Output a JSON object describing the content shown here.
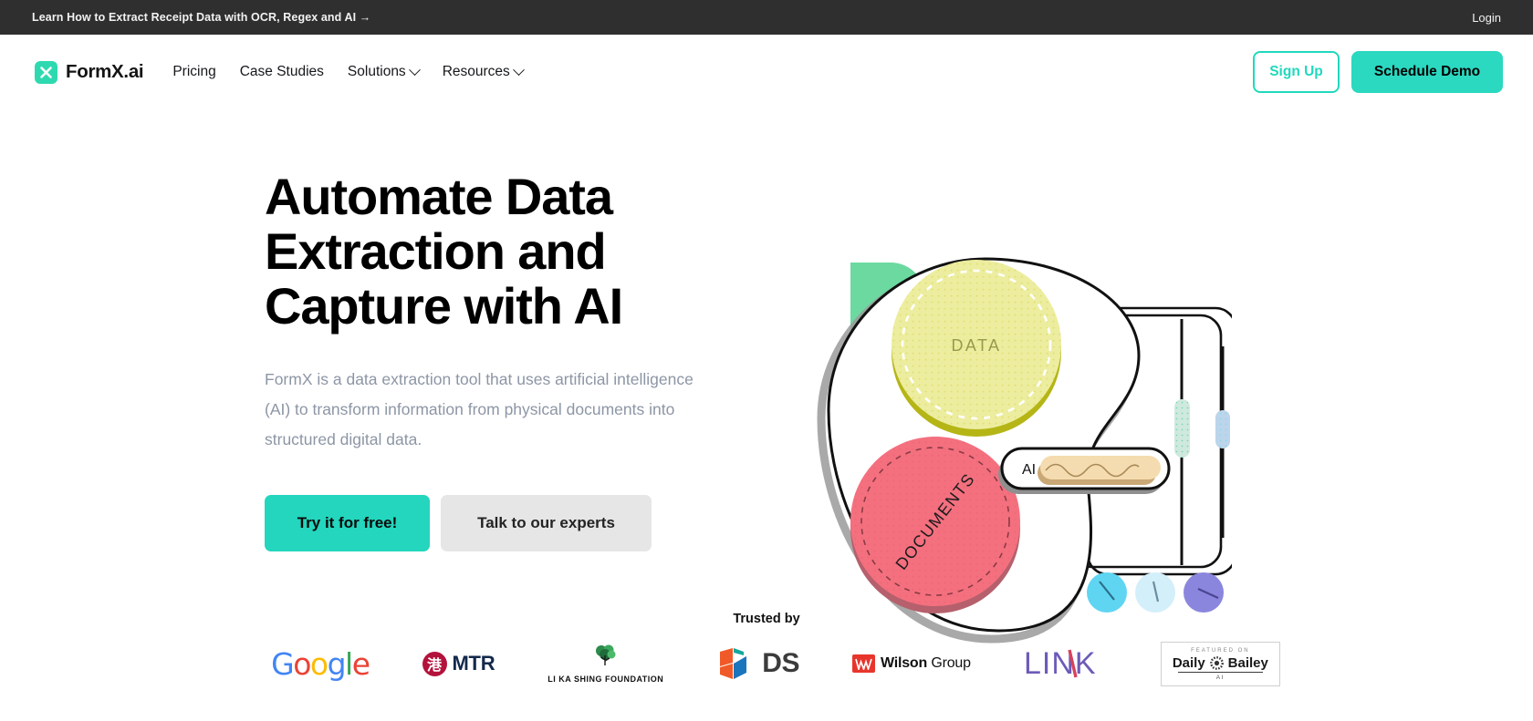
{
  "topbar": {
    "announcement": "Learn How to Extract Receipt Data with OCR, Regex and AI →",
    "login": "Login"
  },
  "nav": {
    "brand": "FormX.ai",
    "links": [
      {
        "label": "Pricing",
        "has_caret": false
      },
      {
        "label": "Case Studies",
        "has_caret": false
      },
      {
        "label": "Solutions",
        "has_caret": true
      },
      {
        "label": "Resources",
        "has_caret": true
      }
    ],
    "signup": "Sign Up",
    "demo": "Schedule Demo"
  },
  "hero": {
    "title": "Automate Data Extraction and Capture with AI",
    "subtitle": "FormX is a data extraction tool that uses artificial intelligence (AI) to transform information from physical documents into structured digital data.",
    "cta_primary": "Try it for free!",
    "cta_secondary": "Talk to our experts",
    "illustration": {
      "data_label": "DATA",
      "documents_label": "DOCUMENTS",
      "ai_label": "AI"
    }
  },
  "trusted": {
    "label": "Trusted by",
    "logos": [
      {
        "name": "Google"
      },
      {
        "name": "MTR",
        "mark": "港"
      },
      {
        "name": "LI KA SHING FOUNDATION"
      },
      {
        "name": "DS"
      },
      {
        "name": "Wilson Group",
        "bold": "Wilson",
        "rest": " Group"
      },
      {
        "name": "LINK"
      },
      {
        "name": "Daily Bailey",
        "top": "FEATURED ON",
        "left": "Daily",
        "right": "Bailey",
        "bottom": "AI"
      }
    ]
  },
  "colors": {
    "teal": "#2bd8c0",
    "dark_bar": "#2f2f2f",
    "muted_text": "#8d96a5",
    "yellow": "#ecec6e",
    "pink": "#f4707f",
    "green": "#6bd9a0"
  }
}
